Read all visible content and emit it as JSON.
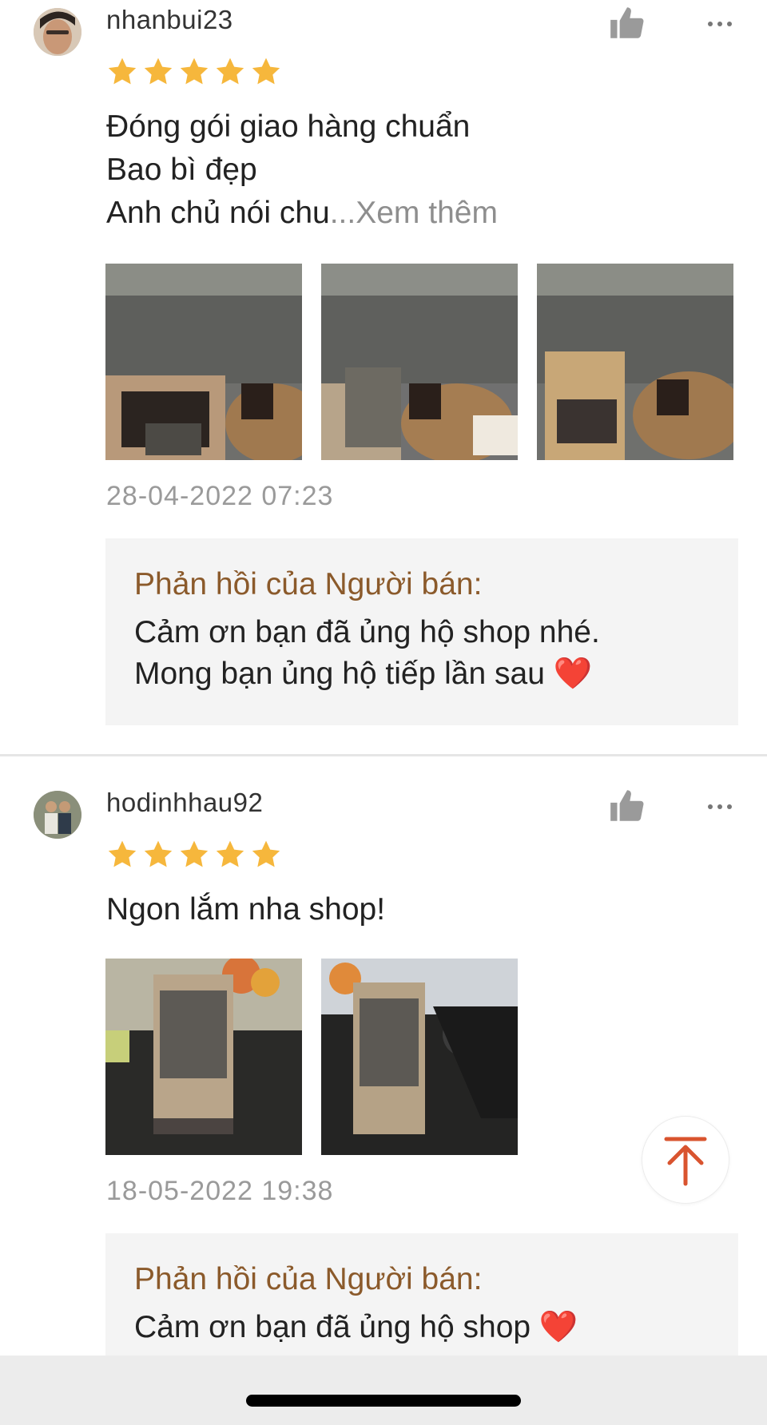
{
  "reviews": [
    {
      "username": "nhanbui23",
      "rating": 5,
      "comment_text": "Đóng gói giao hàng chuẩn\nBao bì đẹp\nAnh chủ nói chu",
      "see_more": "...Xem thêm",
      "photo_count": 3,
      "timestamp": "28-04-2022 07:23",
      "reply": {
        "title": "Phản hồi của Người bán:",
        "text": "Cảm ơn bạn đã ủng hộ shop nhé.\nMong bạn ủng hộ tiếp lần sau ❤️"
      }
    },
    {
      "username": "hodinhhau92",
      "rating": 5,
      "comment_text": "Ngon lắm nha shop!",
      "photo_count": 2,
      "timestamp": "18-05-2022 19:38",
      "reply": {
        "title": "Phản hồi của Người bán:",
        "text": "Cảm ơn bạn đã ủng hộ shop ❤️"
      }
    }
  ],
  "icons": {
    "like": "thumbs-up-icon",
    "more": "more-dots-icon",
    "star": "star-icon",
    "scroll_top": "arrow-up-to-top-icon"
  },
  "colors": {
    "star": "#F6B73C",
    "reply_title": "#8B5A2B",
    "scroll_top_arrow": "#D9542F",
    "timestamp": "#9A9A9A",
    "see_more": "#8E8E8E"
  }
}
